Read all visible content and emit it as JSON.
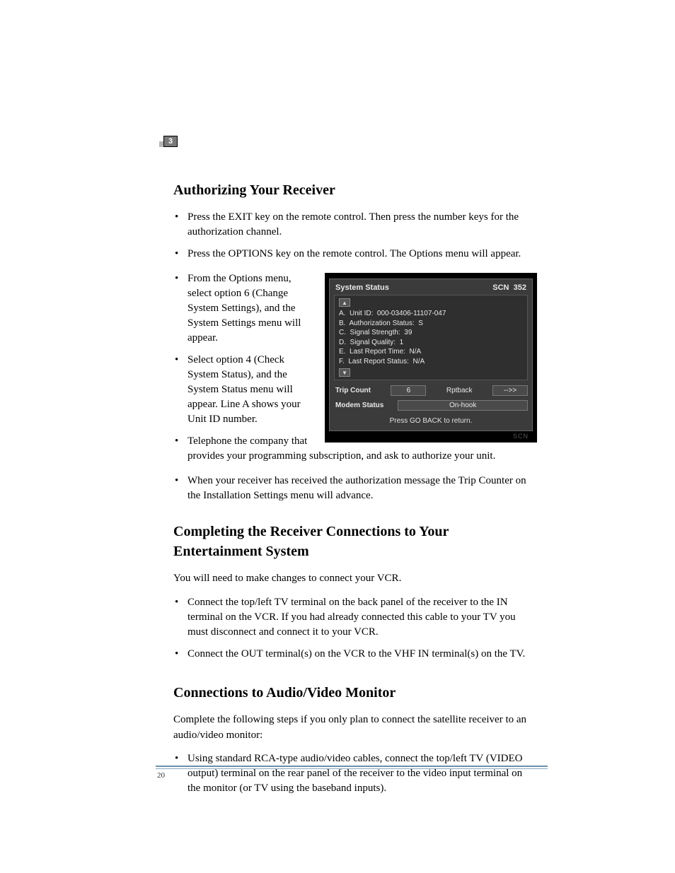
{
  "chapter_number": "3",
  "page_number": "20",
  "section1": {
    "title": "Authorizing Your Receiver",
    "bullets": [
      "Press the EXIT key on the remote control. Then press the number keys for the authorization channel.",
      "Press the OPTIONS key on the remote control. The Options menu will appear.",
      "From the Options menu, select option 6 (Change System Settings), and the System Settings menu will appear.",
      "Select option 4 (Check System Status), and the System Status menu will appear. Line A shows your Unit ID number.",
      "Telephone the company that provides your programming subscription, and ask to authorize your unit.",
      "When your receiver has received the authorization message the Trip Counter on the Installation Settings menu will advance."
    ]
  },
  "section2": {
    "title": "Completing the Receiver Connections to Your Entertainment System",
    "intro": "You will need to make changes to connect your VCR.",
    "bullets": [
      "Connect the top/left TV terminal on the back panel of the receiver to the IN terminal on the VCR. If you had already connected this cable to your TV you must disconnect and connect it to your VCR.",
      "Connect the OUT terminal(s) on the VCR to the VHF IN terminal(s) on the TV."
    ]
  },
  "section3": {
    "title": "Connections to Audio/Video Monitor",
    "intro": "Complete the following steps if you only plan to connect the satellite receiver to an audio/video monitor:",
    "bullets": [
      "Using standard RCA-type audio/video cables, connect the top/left  TV (VIDEO output) terminal on the rear panel of the receiver to the video input terminal on the monitor (or TV using the baseband inputs)."
    ]
  },
  "screenshot": {
    "title": "System Status",
    "scn_label": "SCN",
    "scn_value": "352",
    "arrow_up": "▲",
    "arrow_down": "▼",
    "lines": {
      "a_label": "A.  Unit ID:",
      "a_value": "000-03406-11107-047",
      "b_label": "B.  Authorization Status:",
      "b_value": "S",
      "c_label": "C.  Signal Strength:",
      "c_value": "39",
      "d_label": "D.  Signal Quality:",
      "d_value": "1",
      "e_label": "E.  Last Report Time:",
      "e_value": "N/A",
      "f_label": "F.  Last Report Status:",
      "f_value": "N/A"
    },
    "trip_label": "Trip Count",
    "trip_value": "6",
    "rptback_label": "Rptback",
    "rptback_value": "-->>",
    "modem_label": "Modem Status",
    "modem_value": "On-hook",
    "footer": "Press GO BACK to return.",
    "brand": "SCN"
  }
}
